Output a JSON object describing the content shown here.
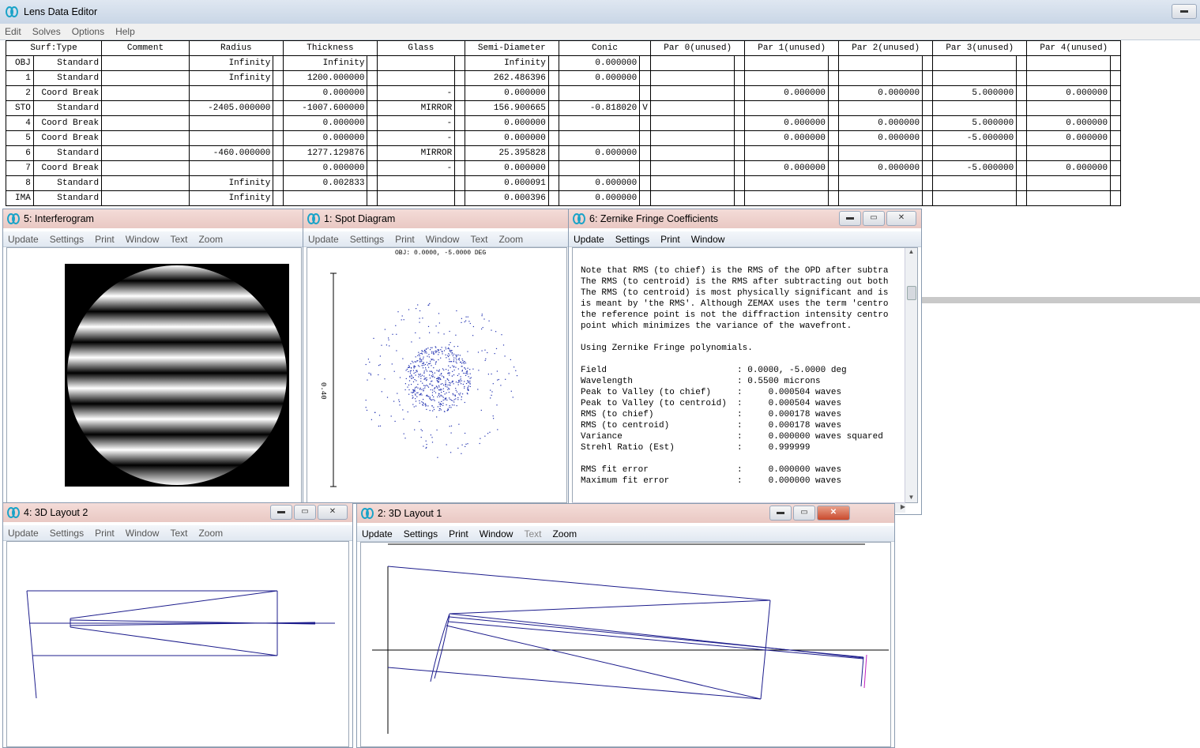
{
  "lde": {
    "title": "Lens Data Editor",
    "menu": [
      "Edit",
      "Solves",
      "Options",
      "Help"
    ],
    "columns": [
      "Surf:Type",
      "Comment",
      "Radius",
      "Thickness",
      "Glass",
      "Semi-Diameter",
      "Conic",
      "Par 0(unused)",
      "Par 1(unused)",
      "Par 2(unused)",
      "Par 3(unused)",
      "Par 4(unused)"
    ],
    "rows": [
      {
        "surf": "OBJ",
        "type": "Standard",
        "comment": "",
        "radius": "Infinity",
        "thickness": "Infinity",
        "glass": "",
        "semi": "Infinity",
        "conic": "0.000000",
        "flag": "",
        "p0": "",
        "p1": "",
        "p2": "",
        "p3": "",
        "p4": ""
      },
      {
        "surf": "1",
        "type": "Standard",
        "comment": "",
        "radius": "Infinity",
        "thickness": "1200.000000",
        "glass": "",
        "semi": "262.486396",
        "conic": "0.000000",
        "flag": "",
        "p0": "",
        "p1": "",
        "p2": "",
        "p3": "",
        "p4": ""
      },
      {
        "surf": "2",
        "type": "Coord Break",
        "comment": "",
        "radius": "",
        "thickness": "0.000000",
        "glass": "-",
        "semi": "0.000000",
        "conic": "",
        "flag": "",
        "p0": "",
        "p1": "0.000000",
        "p2": "0.000000",
        "p3": "5.000000",
        "p4": "0.000000"
      },
      {
        "surf": "STO",
        "type": "Standard",
        "comment": "",
        "radius": "-2405.000000",
        "thickness": "-1007.600000",
        "glass": "MIRROR",
        "semi": "156.900665",
        "conic": "-0.818020",
        "flag": "V",
        "p0": "",
        "p1": "",
        "p2": "",
        "p3": "",
        "p4": ""
      },
      {
        "surf": "4",
        "type": "Coord Break",
        "comment": "",
        "radius": "",
        "thickness": "0.000000",
        "glass": "-",
        "semi": "0.000000",
        "conic": "",
        "flag": "",
        "p0": "",
        "p1": "0.000000",
        "p2": "0.000000",
        "p3": "5.000000",
        "p4": "0.000000"
      },
      {
        "surf": "5",
        "type": "Coord Break",
        "comment": "",
        "radius": "",
        "thickness": "0.000000",
        "glass": "-",
        "semi": "0.000000",
        "conic": "",
        "flag": "",
        "p0": "",
        "p1": "0.000000",
        "p2": "0.000000",
        "p3": "-5.000000",
        "p4": "0.000000"
      },
      {
        "surf": "6",
        "type": "Standard",
        "comment": "",
        "radius": "-460.000000",
        "thickness": "1277.129876",
        "glass": "MIRROR",
        "semi": "25.395828",
        "conic": "0.000000",
        "flag": "",
        "p0": "",
        "p1": "",
        "p2": "",
        "p3": "",
        "p4": ""
      },
      {
        "surf": "7",
        "type": "Coord Break",
        "comment": "",
        "radius": "",
        "thickness": "0.000000",
        "glass": "-",
        "semi": "0.000000",
        "conic": "",
        "flag": "",
        "p0": "",
        "p1": "0.000000",
        "p2": "0.000000",
        "p3": "-5.000000",
        "p4": "0.000000"
      },
      {
        "surf": "8",
        "type": "Standard",
        "comment": "",
        "radius": "Infinity",
        "thickness": "0.002833",
        "glass": "",
        "semi": "0.000091",
        "conic": "0.000000",
        "flag": "",
        "p0": "",
        "p1": "",
        "p2": "",
        "p3": "",
        "p4": ""
      },
      {
        "surf": "IMA",
        "type": "Standard",
        "comment": "",
        "radius": "Infinity",
        "thickness": "",
        "glass": "",
        "semi": "0.000396",
        "conic": "0.000000",
        "flag": "",
        "p0": "",
        "p1": "",
        "p2": "",
        "p3": "",
        "p4": ""
      }
    ]
  },
  "interferogram": {
    "title": "5: Interferogram",
    "menu": [
      "Update",
      "Settings",
      "Print",
      "Window",
      "Text",
      "Zoom"
    ],
    "fringe_count": 7
  },
  "spot": {
    "title": "1: Spot Diagram",
    "menu": [
      "Update",
      "Settings",
      "Print",
      "Window",
      "Text",
      "Zoom"
    ],
    "field_label": "OBJ: 0.0000, -5.0000 DEG",
    "scale_label": "0.40"
  },
  "zernike": {
    "title": "6: Zernike Fringe Coefficients",
    "menu": [
      "Update",
      "Settings",
      "Print",
      "Window"
    ],
    "lines": [
      "Note that RMS (to chief) is the RMS of the OPD after subtra",
      "The RMS (to centroid) is the RMS after subtracting out both",
      "The RMS (to centroid) is most physically significant and is",
      "is meant by 'the RMS'. Although ZEMAX uses the term 'centro",
      "the reference point is not the diffraction intensity centro",
      "point which minimizes the variance of the wavefront.",
      "",
      "Using Zernike Fringe polynomials.",
      "",
      "Field                         : 0.0000, -5.0000 deg",
      "Wavelength                    : 0.5500 microns",
      "Peak to Valley (to chief)     :     0.000504 waves",
      "Peak to Valley (to centroid)  :     0.000504 waves",
      "RMS (to chief)                :     0.000178 waves",
      "RMS (to centroid)             :     0.000178 waves",
      "Variance                      :     0.000000 waves squared",
      "Strehl Ratio (Est)            :     0.999999",
      "",
      "RMS fit error                 :     0.000000 waves",
      "Maximum fit error             :     0.000000 waves"
    ]
  },
  "layout2": {
    "title": "4: 3D Layout 2",
    "menu": [
      "Update",
      "Settings",
      "Print",
      "Window",
      "Text",
      "Zoom"
    ]
  },
  "layout1": {
    "title": "2: 3D Layout 1",
    "menu": [
      "Update",
      "Settings",
      "Print",
      "Window",
      "Text",
      "Zoom"
    ]
  },
  "colors": {
    "ray": "#1c1c8c",
    "spot": "#2030b0",
    "image": "#c020c0"
  }
}
